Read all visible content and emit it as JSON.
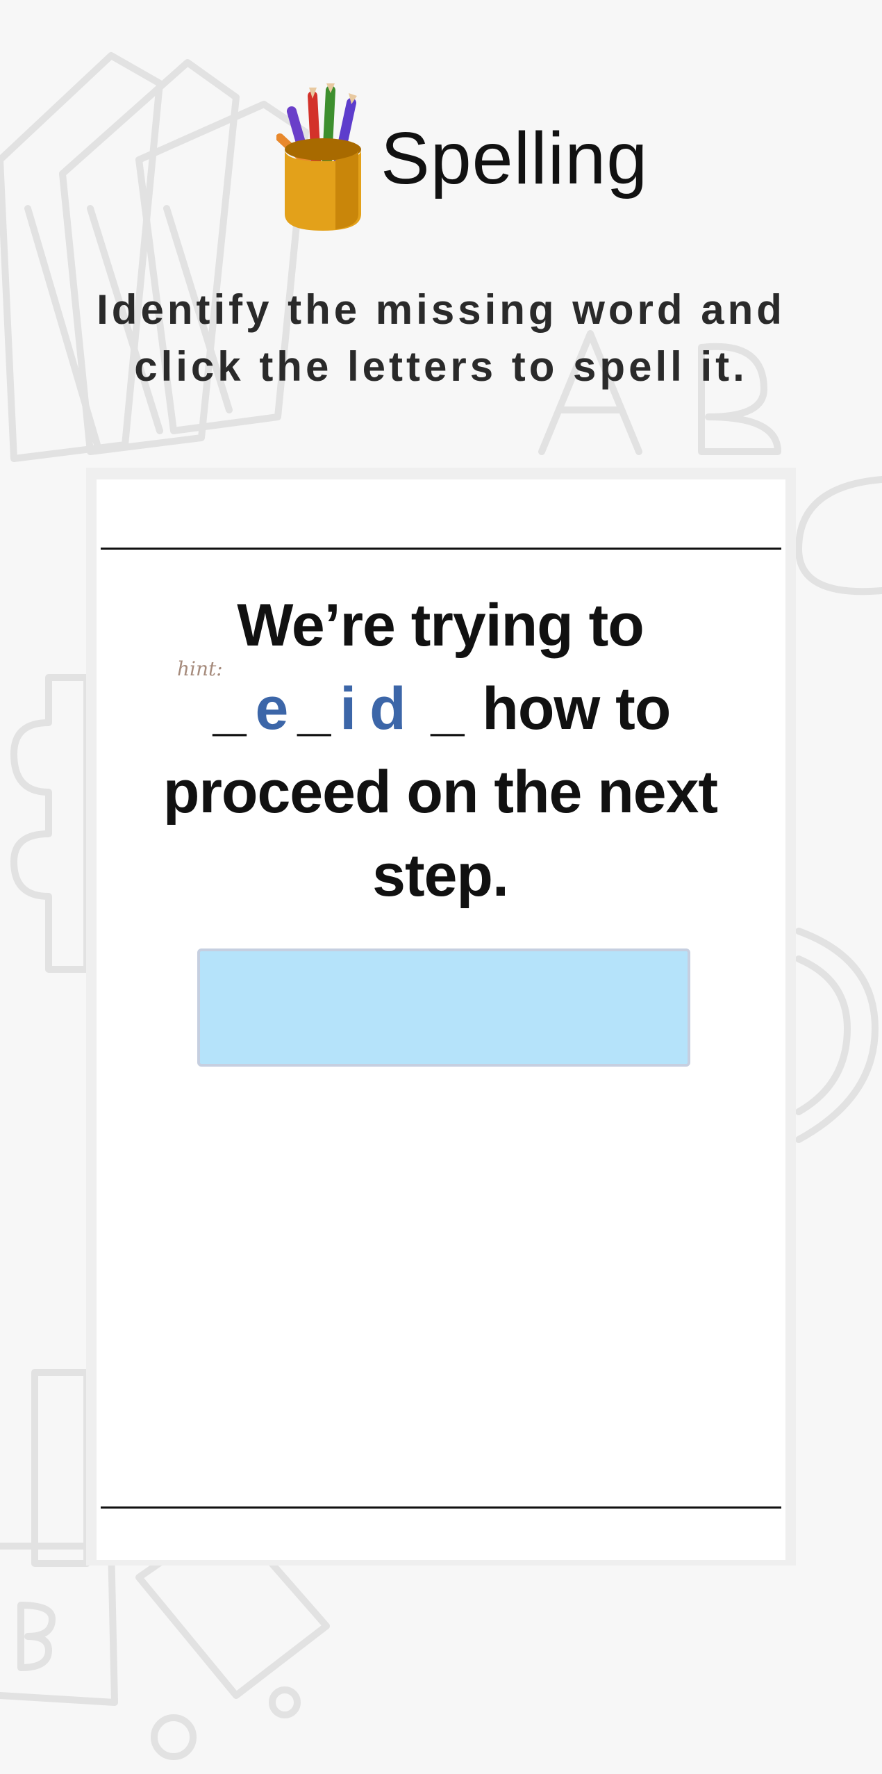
{
  "header": {
    "title": "Spelling",
    "icon": "pencil-cup-icon"
  },
  "instructions": {
    "line1": "Identify the missing word and",
    "line2": "click the letters to spell it."
  },
  "puzzle": {
    "hint_label": "hint:",
    "before": "We’re trying to",
    "word_slots": [
      "_",
      "e",
      "_",
      "i",
      "d",
      "_"
    ],
    "after": "how to proceed on the next step."
  },
  "answer": {
    "value": ""
  },
  "colors": {
    "background": "#f7f7f7",
    "card": "#ffffff",
    "hint_letters": "#3c66a8",
    "answer_box": "#b5e3fa",
    "hint_label": "#a68b7c"
  }
}
